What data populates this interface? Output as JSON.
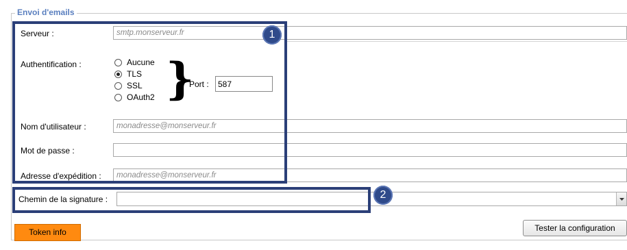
{
  "group": {
    "title": "Envoi d'emails"
  },
  "server": {
    "label": "Serveur :",
    "placeholder": "smtp.monserveur.fr"
  },
  "auth": {
    "label": "Authentification :",
    "options": [
      "Aucune",
      "TLS",
      "SSL",
      "OAuth2"
    ],
    "selected": "TLS",
    "brace": "}"
  },
  "port": {
    "label": "Port :",
    "value": "587"
  },
  "username": {
    "label": "Nom d'utilisateur :",
    "placeholder": "monadresse@monserveur.fr"
  },
  "password": {
    "label": "Mot de passe :",
    "value": ""
  },
  "sender": {
    "label": "Adresse d'expédition :",
    "placeholder": "monadresse@monserveur.fr"
  },
  "signature": {
    "label": "Chemin de la signature :",
    "value": ""
  },
  "badges": [
    "1",
    "2"
  ],
  "buttons": {
    "token": "Token info",
    "test": "Tester la configuration"
  },
  "colors": {
    "highlight": "#2b3f78",
    "token_button": "#ff8a10",
    "group_title": "#5a7fbf"
  },
  "icons": {
    "dropdown": "chevron-down-icon"
  }
}
